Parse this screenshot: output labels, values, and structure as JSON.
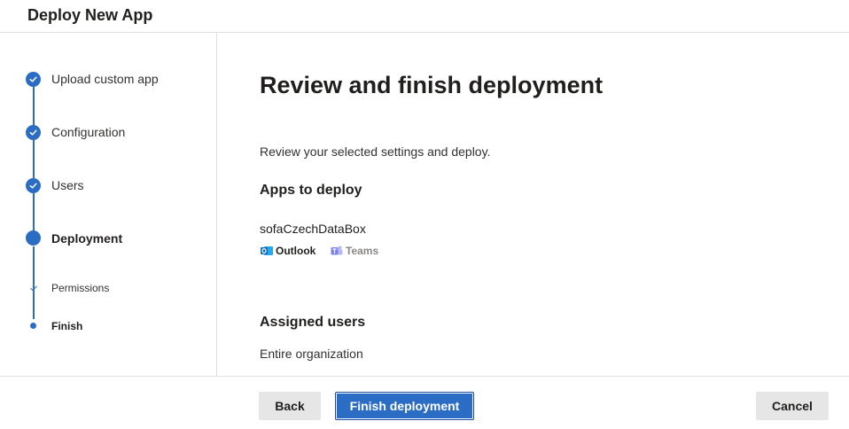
{
  "header": {
    "title": "Deploy New App"
  },
  "steps": [
    {
      "label": "Upload custom app",
      "state": "complete"
    },
    {
      "label": "Configuration",
      "state": "complete"
    },
    {
      "label": "Users",
      "state": "complete"
    },
    {
      "label": "Deployment",
      "state": "current"
    }
  ],
  "substeps": [
    {
      "label": "Permissions",
      "state": "complete"
    },
    {
      "label": "Finish",
      "state": "current"
    }
  ],
  "main": {
    "title": "Review and finish deployment",
    "description": "Review your selected settings and deploy.",
    "apps_heading": "Apps to deploy",
    "app_name": "sofaCzechDataBox",
    "hosts": [
      {
        "label": "Outlook",
        "icon": "outlook-icon",
        "color": "#201f1e"
      },
      {
        "label": "Teams",
        "icon": "teams-icon",
        "color": "#8a8886"
      }
    ],
    "assigned_heading": "Assigned users",
    "assigned_value": "Entire organization"
  },
  "footer": {
    "back_label": "Back",
    "finish_label": "Finish deployment",
    "cancel_label": "Cancel"
  },
  "colors": {
    "accent": "#2b6cc4",
    "outlook": "#0f6cbd",
    "teams": "#7b83eb"
  }
}
